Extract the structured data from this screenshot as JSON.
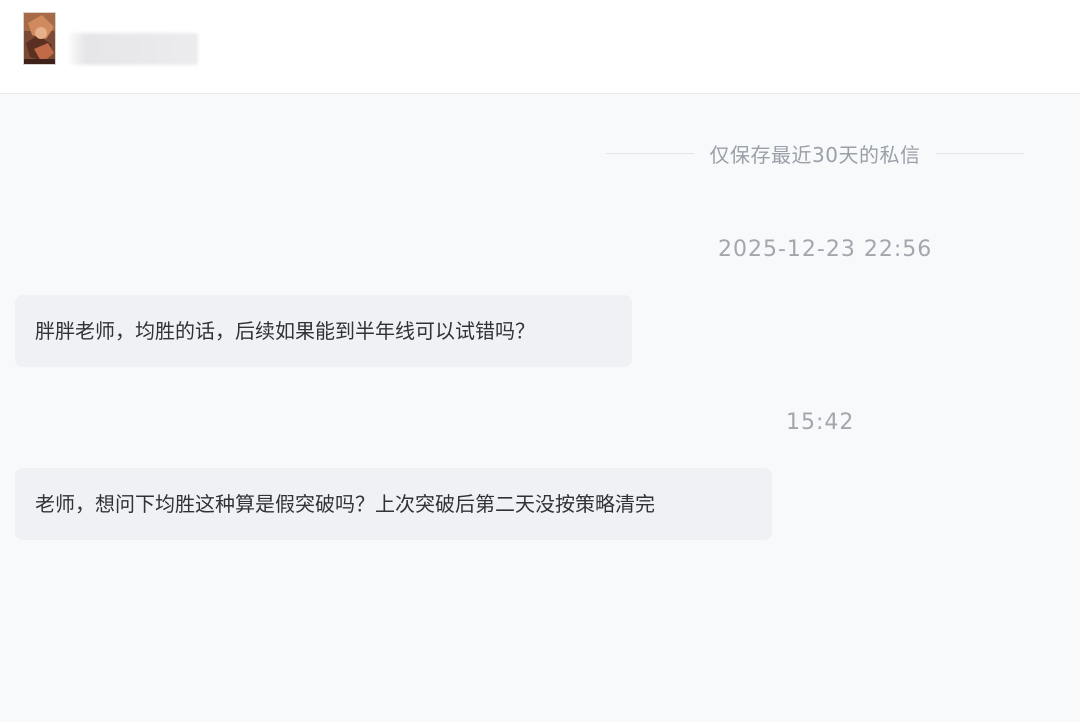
{
  "header": {
    "avatar_icon": "user-avatar-image",
    "username_obscured": true
  },
  "chat": {
    "notice": "仅保存最近30天的私信",
    "messages": [
      {
        "timestamp": "2025-12-23 22:56",
        "text": "胖胖老师，均胜的话，后续如果能到半年线可以试错吗？"
      },
      {
        "timestamp": "15:42",
        "text": "老师，想问下均胜这种算是假突破吗？上次突破后第二天没按策略清完"
      }
    ]
  },
  "colors": {
    "background": "#f8f9fb",
    "bubble": "#f0f1f4",
    "text": "#2f3338",
    "muted_text": "#9aa0a8"
  }
}
